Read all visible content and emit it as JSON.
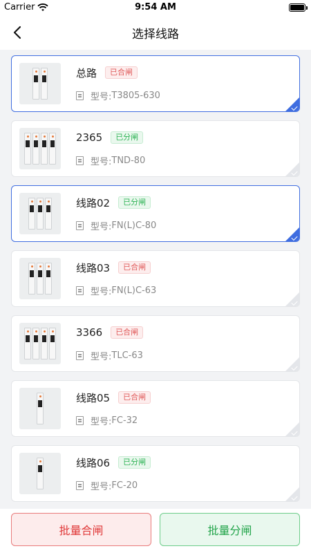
{
  "status_bar": {
    "carrier": "Carrier",
    "time": "9:54 AM"
  },
  "header": {
    "title": "选择线路",
    "back_icon": "chevron-left-icon"
  },
  "model_prefix": "型号:",
  "lines": [
    {
      "name": "总路",
      "status": "已合闸",
      "status_type": "closed",
      "model": "T3805-630",
      "selected": true,
      "poles": 2
    },
    {
      "name": "2365",
      "status": "已分闸",
      "status_type": "open",
      "model": "TND-80",
      "selected": false,
      "poles": 4
    },
    {
      "name": "线路02",
      "status": "已分闸",
      "status_type": "open",
      "model": "FN(L)C-80",
      "selected": true,
      "poles": 3
    },
    {
      "name": "线路03",
      "status": "已合闸",
      "status_type": "closed",
      "model": "FN(L)C-63",
      "selected": false,
      "poles": 3
    },
    {
      "name": "3366",
      "status": "已合闸",
      "status_type": "closed",
      "model": "TLC-63",
      "selected": false,
      "poles": 4
    },
    {
      "name": "线路05",
      "status": "已合闸",
      "status_type": "closed",
      "model": "FC-32",
      "selected": false,
      "poles": 1
    },
    {
      "name": "线路06",
      "status": "已分闸",
      "status_type": "open",
      "model": "FC-20",
      "selected": false,
      "poles": 1
    }
  ],
  "actions": {
    "batch_close": "批量合闸",
    "batch_open": "批量分闸"
  },
  "colors": {
    "accent": "#3f6de0",
    "closed": "#e05a5a",
    "open": "#2fb355"
  }
}
